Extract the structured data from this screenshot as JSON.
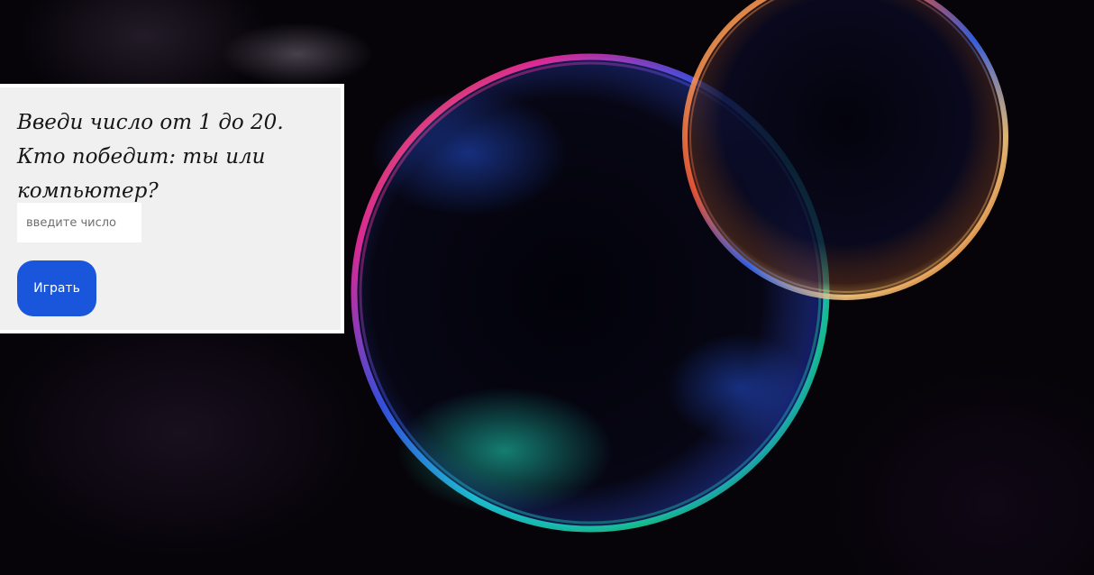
{
  "game": {
    "prompt_line1": "Введи число от 1 до 20.",
    "prompt_line2": "Кто победит: ты или компьютер?",
    "input": {
      "value": "",
      "placeholder": "введите число"
    },
    "play_label": "Играть"
  },
  "colors": {
    "panel_background": "#f0f0f0",
    "button_accent": "#1a56db",
    "page_background": "#060309"
  },
  "background_image": "soap-bubbles-on-dark-background"
}
